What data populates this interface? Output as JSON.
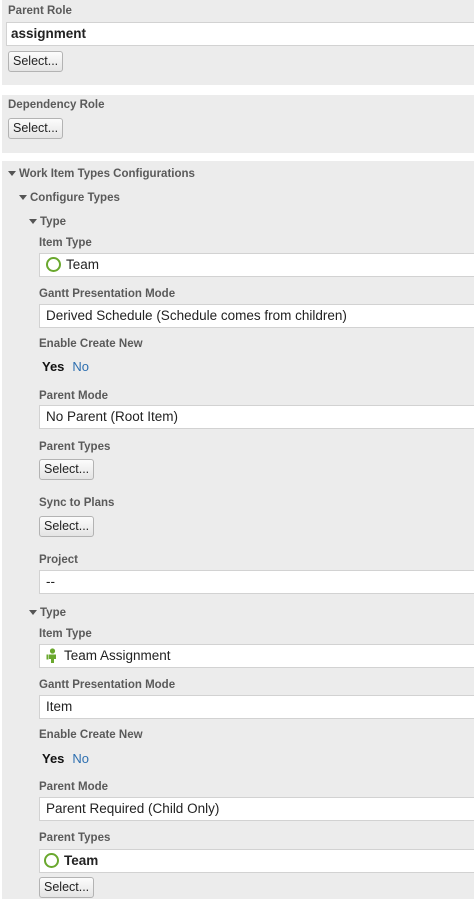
{
  "parent_role": {
    "label": "Parent Role",
    "value": "assignment",
    "select_label": "Select..."
  },
  "dependency_role": {
    "label": "Dependency Role",
    "select_label": "Select..."
  },
  "config": {
    "title": "Work Item Types Configurations",
    "configure_types": "Configure Types",
    "types": [
      {
        "header": "Type",
        "item_type_label": "Item Type",
        "item_type_value": "Team",
        "gantt_label": "Gantt Presentation Mode",
        "gantt_value": "Derived Schedule (Schedule comes from children)",
        "create_label": "Enable Create New",
        "yes": "Yes",
        "no": "No",
        "parent_mode_label": "Parent Mode",
        "parent_mode_value": "No Parent (Root Item)",
        "parent_types_label": "Parent Types",
        "parent_types_select": "Select...",
        "sync_label": "Sync to Plans",
        "sync_select": "Select...",
        "project_label": "Project",
        "project_value": "--"
      },
      {
        "header": "Type",
        "item_type_label": "Item Type",
        "item_type_value": "Team Assignment",
        "gantt_label": "Gantt Presentation Mode",
        "gantt_value": "Item",
        "create_label": "Enable Create New",
        "yes": "Yes",
        "no": "No",
        "parent_mode_label": "Parent Mode",
        "parent_mode_value": "Parent Required (Child Only)",
        "parent_types_label": "Parent Types",
        "parent_types_value": "Team",
        "parent_types_select": "Select..."
      }
    ]
  },
  "icons": {
    "team": "green-ring-icon",
    "team_assignment": "green-person-icon",
    "collapse": "caret-down-icon"
  },
  "colors": {
    "panel": "#ececec",
    "team_icon": "#6aa82e",
    "link": "#2d6fb0"
  }
}
